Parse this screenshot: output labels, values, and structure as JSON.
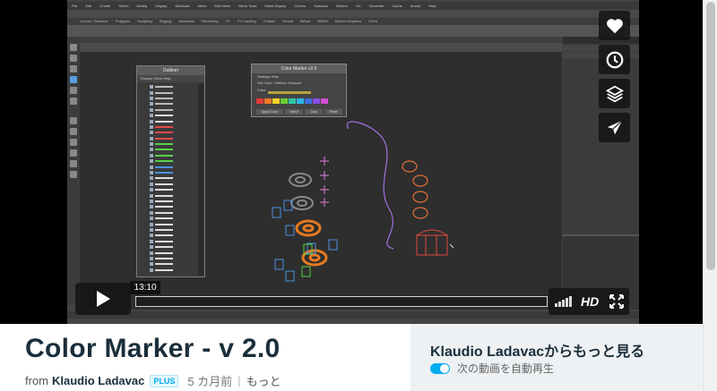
{
  "player": {
    "timecode": "13:10",
    "hd_label": "HD",
    "volume_level": 0.8
  },
  "maya": {
    "menu_items": [
      "File",
      "Edit",
      "Create",
      "Select",
      "Modify",
      "Display",
      "Windows",
      "Mesh",
      "Edit Mesh",
      "Mesh Tools",
      "Mesh Display",
      "Curves",
      "Surfaces",
      "Deform",
      "UV",
      "Generate",
      "Cache",
      "Arnold",
      "Help"
    ],
    "shelf_tabs": [
      "Curves / Surfaces",
      "Polygons",
      "Sculpting",
      "Rigging",
      "Animation",
      "Rendering",
      "FX",
      "FX Caching",
      "Custom",
      "Arnold",
      "Bifrost",
      "MASH",
      "Motion Graphics",
      "XGen"
    ]
  },
  "outliner": {
    "title": "Outliner",
    "menu": "Display   Show   Help"
  },
  "color_marker": {
    "title": "Color Marker v2.0",
    "menu": "Settings    Help",
    "option_row": "Set Color:        Outliner      Viewport",
    "color_label": "Color:",
    "swatches": [
      "#e23b3b",
      "#f07a2a",
      "#f3d02a",
      "#6ccf3a",
      "#2fc7a2",
      "#2bb7e8",
      "#3a6fe0",
      "#8a4fe0",
      "#d04fd0"
    ],
    "buttons": [
      "Apply Color",
      "Select",
      "Copy",
      "Reset"
    ]
  },
  "side_actions": {
    "like": "heart-icon",
    "watch_later": "clock-icon",
    "collections": "layers-icon",
    "share": "paper-plane-icon"
  },
  "video": {
    "title": "Color Marker - v 2.0",
    "from_label": "from",
    "author": "Klaudio Ladavac",
    "badge": "PLUS",
    "posted": "5 カ月前",
    "more_link": "もっと"
  },
  "side_panel": {
    "more_from": "Klaudio Ladavacからもっと見る",
    "autoplay_label": "次の動画を自動再生",
    "autoplay_on": true
  },
  "colors": {
    "accent": "#00adef",
    "title_text": "#1a2e3b"
  }
}
